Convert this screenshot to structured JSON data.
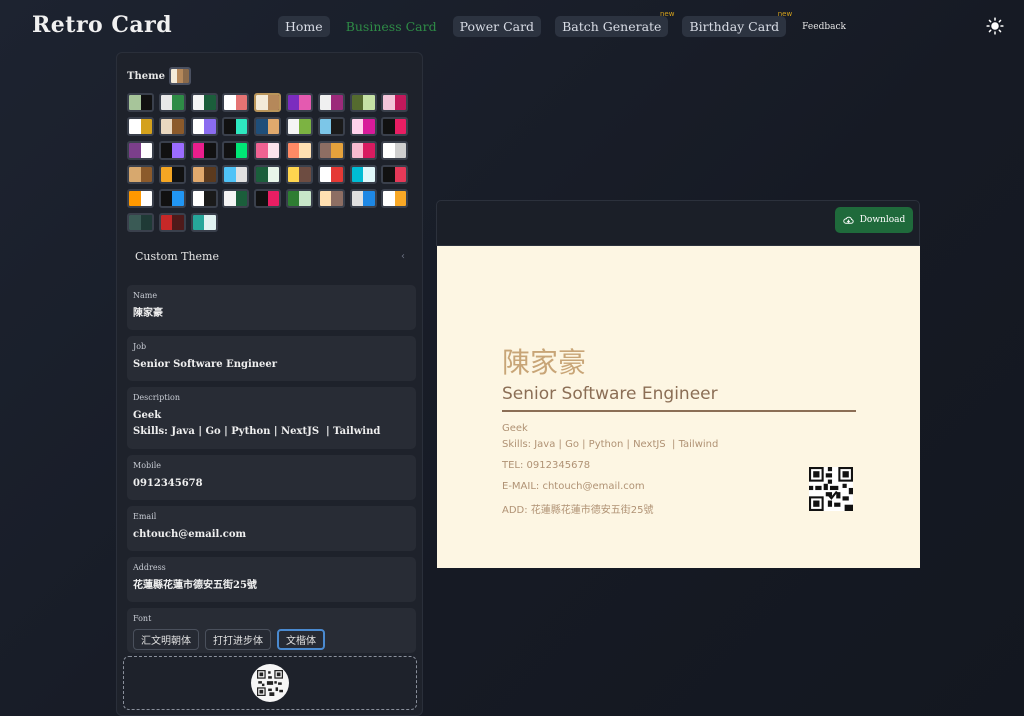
{
  "app": {
    "title": "Retro Card"
  },
  "nav": [
    {
      "label": "Home",
      "style": "pill"
    },
    {
      "label": "Business Card",
      "style": "active"
    },
    {
      "label": "Power Card",
      "style": "pill"
    },
    {
      "label": "Batch Generate",
      "style": "pill",
      "badge": "new"
    },
    {
      "label": "Birthday Card",
      "style": "pill",
      "badge": "new"
    },
    {
      "label": "Feedback",
      "style": "plain"
    }
  ],
  "header": {
    "theme_toggle_icon": "sun-icon"
  },
  "theme": {
    "label": "Theme",
    "current": [
      "#f3ead8",
      "#b5885a",
      "#8a6a4b"
    ],
    "swatches": [
      [
        "#a7c59a",
        "#111111"
      ],
      [
        "#e8e8e8",
        "#2e8b46"
      ],
      [
        "#f5f5f5",
        "#1b5e3b"
      ],
      [
        "#ffffff",
        "#e57373"
      ],
      [
        "#f3ead8",
        "#b5885a"
      ],
      [
        "#7b2cbf",
        "#e45ab0"
      ],
      [
        "#f0f0f0",
        "#9c2a7a"
      ],
      [
        "#556b2f",
        "#c5e1a5"
      ],
      [
        "#f3c4d9",
        "#c2185b"
      ],
      [
        "#ffffff",
        "#d4a11c"
      ],
      [
        "#ead8c0",
        "#8b5a2b"
      ],
      [
        "#ffffff",
        "#8a6cf0"
      ],
      [
        "#111111",
        "#2ee8c0"
      ],
      [
        "#1f4e79",
        "#e0a96d"
      ],
      [
        "#f5f5f5",
        "#7cb342"
      ],
      [
        "#7cc6e8",
        "#1a1a1a"
      ],
      [
        "#ffd1ec",
        "#d81b9a"
      ],
      [
        "#111111",
        "#e91e63"
      ],
      [
        "#7b3f8b",
        "#ffffff"
      ],
      [
        "#111111",
        "#9b6cff"
      ],
      [
        "#e91e8c",
        "#111111"
      ],
      [
        "#111111",
        "#00e676"
      ],
      [
        "#f06292",
        "#fce4ec"
      ],
      [
        "#ff8a65",
        "#ffe0b2"
      ],
      [
        "#8d6e63",
        "#e6a23c"
      ],
      [
        "#f8bbd0",
        "#d81b60"
      ],
      [
        "#ffffff",
        "#cfcfcf"
      ],
      [
        "#d7a86e",
        "#8b5a2b"
      ],
      [
        "#f5a623",
        "#111111"
      ],
      [
        "#e0a96d",
        "#5b3a1e"
      ],
      [
        "#4fc3f7",
        "#e0e0e0"
      ],
      [
        "#1b5e3b",
        "#e8f5e9"
      ],
      [
        "#ffd54f",
        "#6d4c41"
      ],
      [
        "#ffffff",
        "#e53935"
      ],
      [
        "#00bcd4",
        "#e0f7fa"
      ],
      [
        "#111111",
        "#e53958"
      ],
      [
        "#ff9800",
        "#ffffff"
      ],
      [
        "#111111",
        "#2196f3"
      ],
      [
        "#ffffff",
        "#1a1a1a"
      ],
      [
        "#f5f5f5",
        "#1b5e3b"
      ],
      [
        "#111111",
        "#e91e63"
      ],
      [
        "#2e7d32",
        "#c8e6c9"
      ],
      [
        "#ffe0b2",
        "#8d6e63"
      ],
      [
        "#e0e0e0",
        "#1e88e5"
      ],
      [
        "#ffffff",
        "#f9a825"
      ],
      [
        "#3a5a55",
        "#1f3a36"
      ],
      [
        "#c62828",
        "#4e1a1a"
      ],
      [
        "#26a69a",
        "#e0f2f1"
      ]
    ],
    "selected_index": 4
  },
  "custom_theme": {
    "label": "Custom Theme"
  },
  "form": {
    "name": {
      "label": "Name",
      "value": "陳家豪"
    },
    "job": {
      "label": "Job",
      "value": "Senior Software Engineer"
    },
    "description": {
      "label": "Description",
      "value": "Geek\nSkills: Java | Go | Python | NextJS  | Tailwind"
    },
    "mobile": {
      "label": "Mobile",
      "value": "0912345678"
    },
    "email": {
      "label": "Email",
      "value": "chtouch@email.com"
    },
    "address": {
      "label": "Address",
      "value": "花蓮縣花蓮市德安五街25號"
    },
    "font": {
      "label": "Font",
      "options": [
        "汇文明朝体",
        "打打进步体",
        "文楷体"
      ],
      "selected": "文楷体"
    }
  },
  "preview": {
    "download_label": "Download",
    "card": {
      "name": "陳家豪",
      "job": "Senior Software Engineer",
      "description": "Geek\nSkills: Java | Go | Python | NextJS  | Tailwind",
      "tel": "TEL: 0912345678",
      "email": "E-MAIL: chtouch@email.com",
      "address": "ADD: 花蓮縣花蓮市德安五街25號"
    }
  },
  "colors": {
    "accent_green": "#2e8b46",
    "download_bg": "#1f6a3b",
    "card_bg": "#fdf6e3",
    "card_text": "#8b6e55"
  }
}
